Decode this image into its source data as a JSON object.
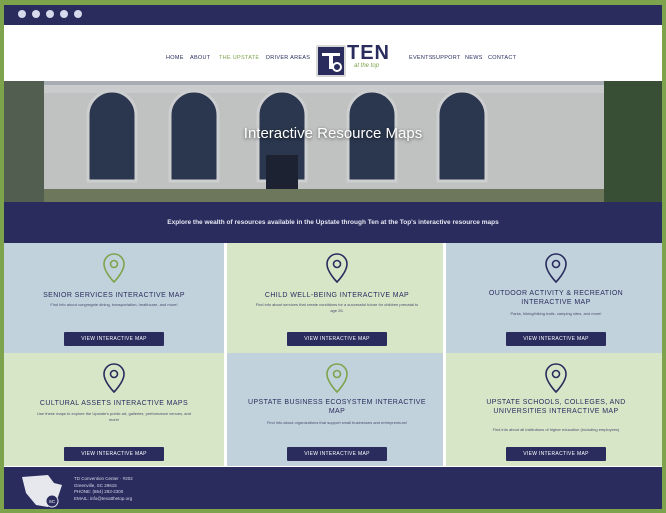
{
  "nav": {
    "items": [
      "HOME",
      "ABOUT",
      "THE UPSTATE",
      "DRIVER AREAS",
      "EVENTS",
      "SUPPORT",
      "NEWS",
      "CONTACT"
    ],
    "active_index": 2
  },
  "logo": {
    "name": "TEN",
    "tagline": "at the top"
  },
  "hero": {
    "title": "Interactive Resource Maps"
  },
  "banner": {
    "text": "Explore the wealth of resources available in the Upstate through Ten at the Top's interactive resource maps"
  },
  "cards": [
    {
      "title": "SENIOR SERVICES INTERACTIVE MAP",
      "desc": "Find info about congregate dining, transportation, healthcare, and more!",
      "button": "VIEW INTERACTIVE MAP",
      "bg": "#c2d2dc"
    },
    {
      "title": "CHILD WELL-BEING INTERACTIVE MAP",
      "desc": "Find info about services that create conditions for a successful future for children prenatal to age 26.",
      "button": "VIEW INTERACTIVE MAP",
      "bg": "#d8e6c8"
    },
    {
      "title": "OUTDOOR ACTIVITY & RECREATION INTERACTIVE MAP",
      "desc": "Parks, hiking/biking trails, camping sites, and more!",
      "button": "VIEW INTERACTIVE MAP",
      "bg": "#c2d2dc"
    },
    {
      "title": "CULTURAL ASSETS INTERACTIVE MAPS",
      "desc": "Use these maps to explore the Upstate's public art, galleries, performance venues, and more!",
      "button": "VIEW INTERACTIVE MAP",
      "bg": "#d8e6c8"
    },
    {
      "title": "UPSTATE BUSINESS ECOSYSTEM INTERACTIVE MAP",
      "desc": "Find info about organizations that support small businesses and entrepreneurs!",
      "button": "VIEW INTERACTIVE MAP",
      "bg": "#c2d2dc"
    },
    {
      "title": "UPSTATE SCHOOLS, COLLEGES, AND UNIVERSITIES INTERACTIVE MAP",
      "desc": "Find info about all institutions of higher education (including employees)",
      "button": "VIEW INTERACTIVE MAP",
      "bg": "#d8e6c8"
    }
  ],
  "footer": {
    "lines": [
      "TD Convention Center · #202",
      "Greenville, SC 29615",
      "PHONE: (864) 283-2300",
      "EMAIL: info@tenatthetop.org"
    ],
    "badge": "SC"
  },
  "colors": {
    "navy": "#2a2c5e",
    "green": "#7da44c",
    "card_blue": "#c2d2dc",
    "card_green": "#d8e6c8"
  },
  "icons": [
    "facebook-icon",
    "twitter-icon",
    "instagram-icon",
    "youtube-icon",
    "linkedin-icon",
    "map-pin-icon"
  ]
}
